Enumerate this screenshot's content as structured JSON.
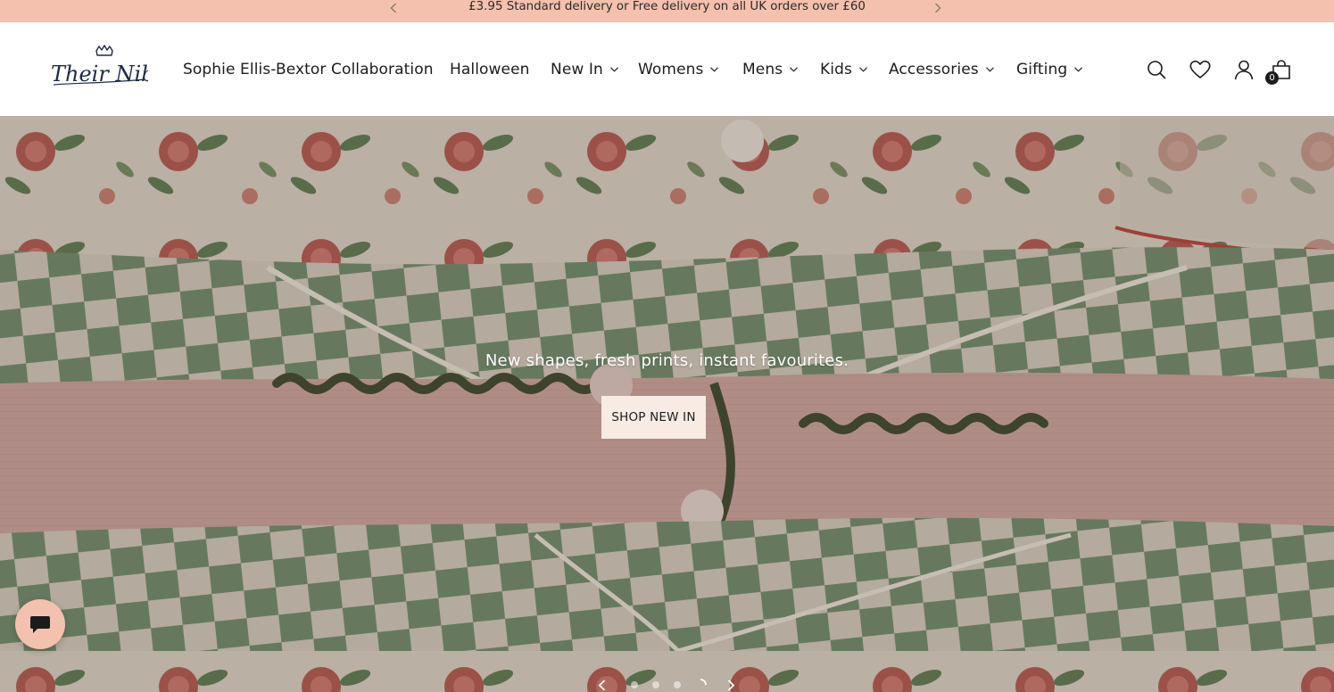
{
  "announcement": {
    "text": "£3.95 Standard delivery or Free delivery on all UK orders over £60",
    "prev_icon": "chevron-left-icon",
    "next_icon": "chevron-right-icon"
  },
  "header": {
    "logo_text": "Their Nibs",
    "nav": [
      {
        "label": "Sophie Ellis-Bextor Collaboration",
        "has_dropdown": false
      },
      {
        "label": "Halloween",
        "has_dropdown": false
      },
      {
        "label": "New In",
        "has_dropdown": true
      },
      {
        "label": "Womens",
        "has_dropdown": true
      },
      {
        "label": "Mens",
        "has_dropdown": true
      },
      {
        "label": "Kids",
        "has_dropdown": true
      },
      {
        "label": "Accessories",
        "has_dropdown": true
      },
      {
        "label": "Gifting",
        "has_dropdown": true
      }
    ],
    "icons": [
      "search-icon",
      "wishlist-heart-icon",
      "account-icon",
      "cart-bag-icon"
    ],
    "cart_count": "0"
  },
  "hero": {
    "caption": "New shapes, fresh prints, instant favourites.",
    "button_label": "SHOP NEW IN",
    "slides_total": 4,
    "active_slide": 4
  },
  "chat": {
    "icon": "chat-bubble-icon"
  },
  "colors": {
    "announcement_bg": "#f3c1ad",
    "button_bg": "#f7ebe3",
    "text": "#1c1c1c"
  }
}
